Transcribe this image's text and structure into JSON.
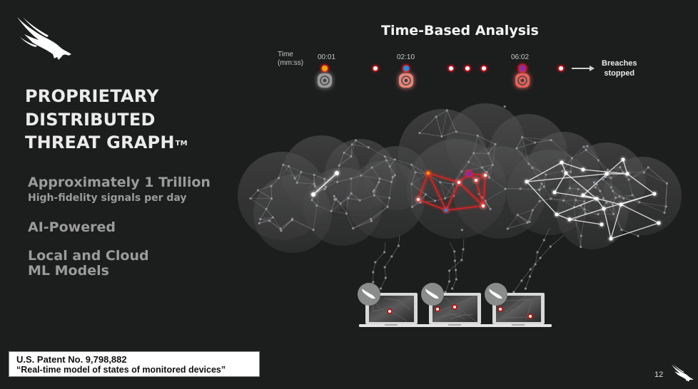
{
  "slide": {
    "headline_lines": [
      "PROPRIETARY",
      "DISTRIBUTED",
      "THREAT GRAPH"
    ],
    "trademark": "TM",
    "features": [
      {
        "title": "Approximately 1 Trillion",
        "subtitle": "High-fidelity signals per day"
      },
      {
        "title": "AI-Powered"
      },
      {
        "title_lines": [
          "Local and Cloud",
          "ML Models"
        ]
      }
    ],
    "patent": {
      "number": "U.S. Patent No. 9,798,882",
      "title": "“Real-time model of states of monitored devices”"
    },
    "page_number": "12",
    "icons": {
      "logo": "falcon-logo-icon",
      "arrow": "arrow-right-icon",
      "shield": "falcon-badge-icon"
    }
  },
  "timeline": {
    "title": "Time-Based Analysis",
    "axis_label_lines": [
      "Time",
      "(mm:ss)"
    ],
    "timestamps": [
      "00:01",
      "02:10",
      "06:02"
    ],
    "end_label_lines": [
      "Breaches",
      "stopped"
    ],
    "colors": {
      "line": "#c8161d",
      "event_orange": "#f5a300",
      "event_blue": "#1e8fe0",
      "event_purple": "#8e2ba0",
      "dot": "#ffffff"
    }
  },
  "graph": {
    "colors": {
      "cloud": "#4a4a4a",
      "mesh": "#8a8a8a",
      "attack_path": "#e02020",
      "benign_path": "#f0f0f0",
      "laptop": "#d9d9d9",
      "badge": "#8a8b8b"
    },
    "endpoints_count": 3
  }
}
